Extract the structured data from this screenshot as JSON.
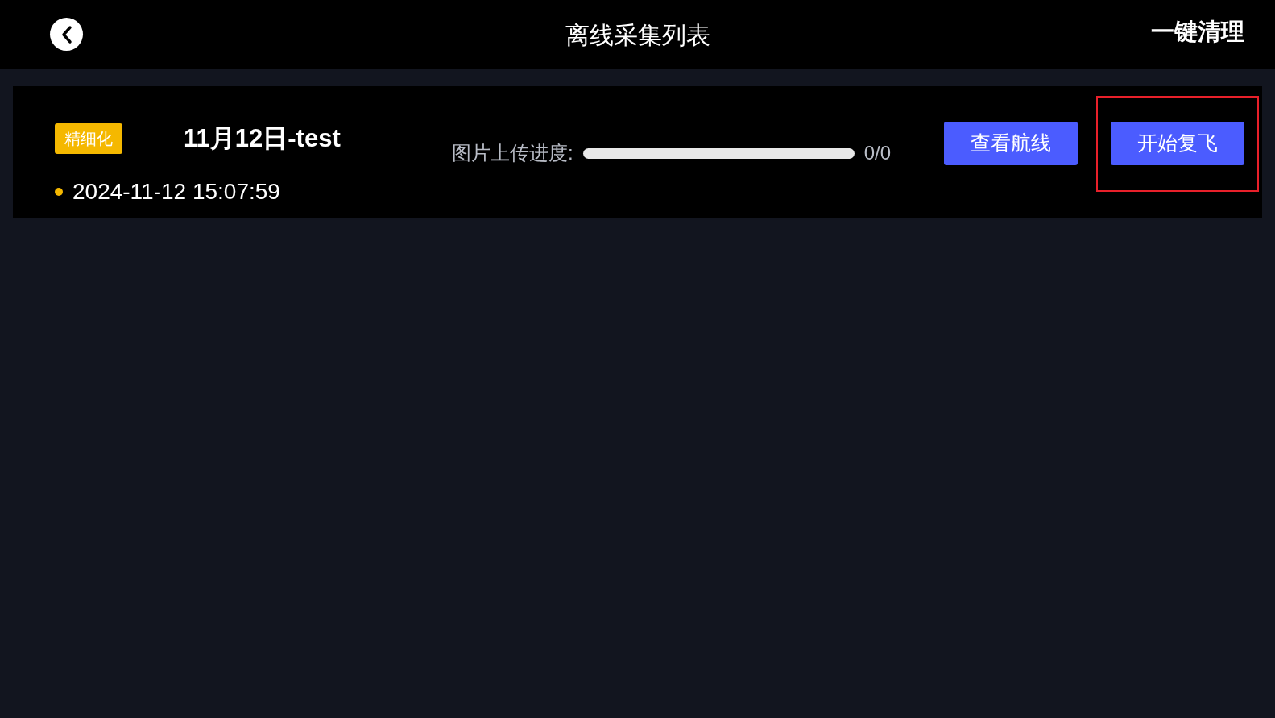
{
  "header": {
    "title": "离线采集列表",
    "action": "一键清理"
  },
  "items": [
    {
      "tag": "精细化",
      "title": "11月12日-test",
      "color": "#f5b800",
      "time": "2024-11-12 15:07:59",
      "progress_label": "图片上传进度:",
      "progress_text": "0/0",
      "buttons": [
        {
          "label": "查看航线",
          "highlighted": false
        },
        {
          "label": "开始复飞",
          "highlighted": true
        }
      ]
    }
  ]
}
